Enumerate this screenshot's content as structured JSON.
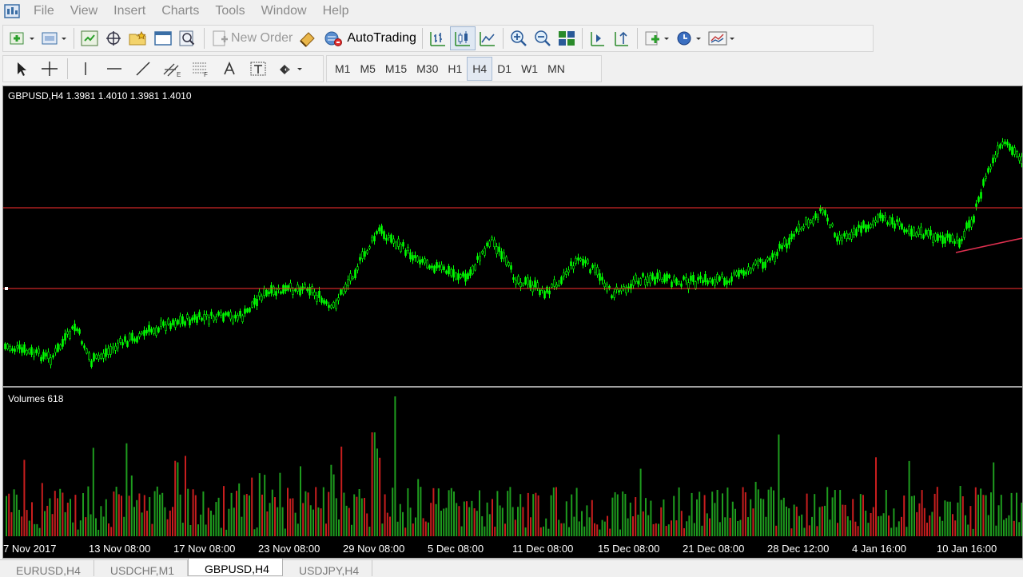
{
  "menu": [
    "File",
    "View",
    "Insert",
    "Charts",
    "Tools",
    "Window",
    "Help"
  ],
  "toolbar": {
    "new_order_label": "New Order",
    "autotrading_label": "AutoTrading"
  },
  "timeframes": [
    "M1",
    "M5",
    "M15",
    "M30",
    "H1",
    "H4",
    "D1",
    "W1",
    "MN"
  ],
  "active_timeframe": "H4",
  "chart": {
    "header": "GBPUSD,H4  1.3981 1.4010 1.3981 1.4010",
    "volume_label": "Volumes 618",
    "date_labels": [
      "7 Nov 2017",
      "13 Nov 08:00",
      "17 Nov 08:00",
      "23 Nov 08:00",
      "29 Nov 08:00",
      "5 Dec 08:00",
      "11 Dec 08:00",
      "15 Dec 08:00",
      "21 Dec 08:00",
      "28 Dec 12:00",
      "4 Jan 16:00",
      "10 Jan 16:00"
    ],
    "colors": {
      "background": "#000000",
      "candle": "#00ff00",
      "hline": "#ff3030",
      "volume_up": "#1e9c1e",
      "volume_down": "#c81e1e",
      "text": "#ffffff",
      "trendline": "#e03050"
    }
  },
  "tabs": [
    "EURUSD,H4",
    "USDCHF,M1",
    "GBPUSD,H4",
    "USDJPY,H4"
  ],
  "active_tab": "GBPUSD,H4"
}
